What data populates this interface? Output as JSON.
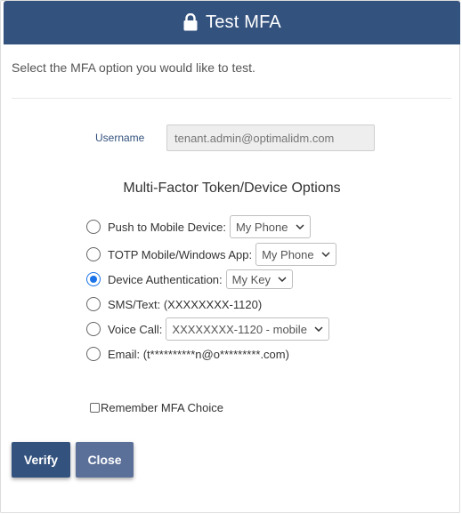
{
  "header": {
    "title": "Test MFA",
    "icon": "lock-icon"
  },
  "intro_text": "Select the MFA option you would like to test.",
  "username": {
    "label": "Username",
    "value": "tenant.admin@optimalidm.com"
  },
  "section_title": "Multi-Factor Token/Device Options",
  "options": [
    {
      "label": "Push to Mobile Device:",
      "selected": false,
      "select_value": "My Phone"
    },
    {
      "label": "TOTP Mobile/Windows App:",
      "selected": false,
      "select_value": "My Phone"
    },
    {
      "label": "Device Authentication:",
      "selected": true,
      "select_value": "My Key"
    },
    {
      "label": "SMS/Text: (XXXXXXXX-1120)",
      "selected": false
    },
    {
      "label": "Voice Call:",
      "selected": false,
      "select_value": "XXXXXXXX-1120 - mobile"
    },
    {
      "label": "Email: (t**********n@o*********.com)",
      "selected": false
    }
  ],
  "remember": {
    "label": "Remember MFA Choice",
    "checked": false
  },
  "buttons": {
    "verify": "Verify",
    "close": "Close"
  },
  "colors": {
    "header": "#33527e",
    "verify_button": "#33527e",
    "close_button": "#5b7099",
    "radio_selected": "#1a73e8"
  }
}
